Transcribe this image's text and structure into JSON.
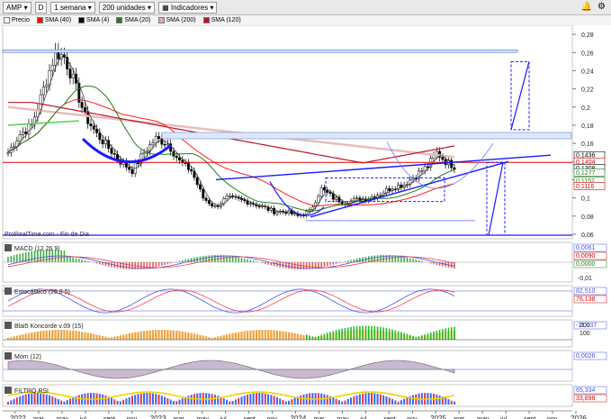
{
  "toolbar": {
    "symbol": "AMP",
    "chart_type": "D",
    "period": "1 semana",
    "units": "200 unidades",
    "indicators": "Indicadores",
    "alert_icon": "bell-icon",
    "settings_icon": "gear-icon"
  },
  "legend": [
    {
      "label": "Precio",
      "color": "#ffffff"
    },
    {
      "label": "SMA (40)",
      "color": "#ff0000"
    },
    {
      "label": "SMA (4)",
      "color": "#000000"
    },
    {
      "label": "SMA (20)",
      "color": "#1e7d1e"
    },
    {
      "label": "SMA (200)",
      "color": "#d9b0b0"
    },
    {
      "label": "SMA (120)",
      "color": "#c0142a"
    }
  ],
  "watermark": "ProRealTime.com - Fin de Dia",
  "price_axis": {
    "ticks": [
      "0,28",
      "0,26",
      "0,24",
      "0,22",
      "0,2",
      "0,18",
      "0,16",
      "0,14",
      "0,12",
      "0,1",
      "0,08",
      "0,06"
    ],
    "badges": [
      {
        "text": "0,1436",
        "color": "#000000"
      },
      {
        "text": "0,1404",
        "color": "#e00000"
      },
      {
        "text": "0,1308",
        "color": "#000000"
      },
      {
        "text": "0,1277",
        "color": "#1e7d1e"
      },
      {
        "text": "0,1152",
        "color": "#1e7d1e"
      },
      {
        "text": "0,1116",
        "color": "#e00000"
      }
    ]
  },
  "panels": {
    "macd": {
      "label": "MACD (12 26 9)",
      "values": [
        "0,0061",
        "0,0090",
        "0,0000"
      ],
      "tick": "-0,01"
    },
    "stoch": {
      "label": "Estocástico (26 8 5)",
      "values": [
        "82,510",
        "76,138"
      ]
    },
    "koncorde": {
      "label": "Blai5 Koncorde v.09 (15)",
      "ticks": [
        "200",
        "100"
      ],
      "value": "-11,037"
    },
    "momentum": {
      "label": "Mom (12)",
      "value": "0,0026"
    },
    "rsi": {
      "label": "FILTRO RSI",
      "values": [
        "65,334",
        "33,898"
      ]
    }
  },
  "time_axis": [
    "2022",
    "mar",
    "may",
    "jul",
    "sept",
    "nov",
    "2023",
    "mar",
    "may",
    "jul",
    "sept",
    "nov",
    "2024",
    "mar",
    "may",
    "jul",
    "sept",
    "nov",
    "2025",
    "mar",
    "may",
    "jul",
    "sept",
    "nov",
    "2026"
  ]
}
